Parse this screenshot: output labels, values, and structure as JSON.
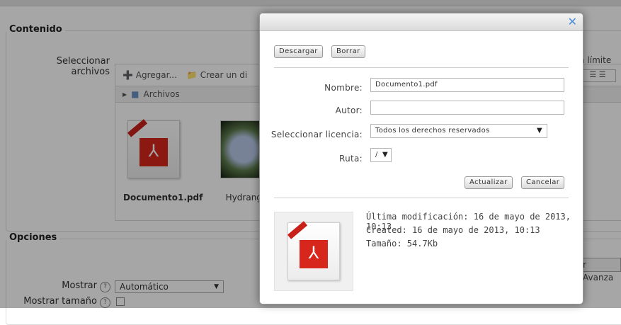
{
  "background": {
    "contenido_legend": "Contenido",
    "select_files_label": "Seleccionar archivos",
    "toolbar": {
      "add": "Agregar...",
      "create": "Crear un di"
    },
    "path_folder": "Archivos",
    "files": [
      {
        "name": "Documento1.pdf"
      },
      {
        "name": "Hydrange"
      }
    ],
    "right_limit_text": "n límite",
    "opciones_legend": "Opciones",
    "advanced_button": "r Avanza",
    "mostrar_label": "Mostrar",
    "mostrar_value": "Automático",
    "mostrar_tamano_label": "Mostrar tamaño"
  },
  "modal": {
    "download_button": "Descargar",
    "delete_button": "Borrar",
    "name_label": "Nombre:",
    "name_value": "Documento1.pdf",
    "author_label": "Autor:",
    "author_value": "",
    "license_label": "Seleccionar licencia:",
    "license_value": "Todos los derechos reservados",
    "path_label": "Ruta:",
    "path_value": "/",
    "update_button": "Actualizar",
    "cancel_button": "Cancelar",
    "last_modified": "Última modificación: 16 de mayo de 2013, 10:13",
    "created": "Created: 16 de mayo de 2013, 10:13",
    "size": "Tamaño: 54.7Kb"
  }
}
